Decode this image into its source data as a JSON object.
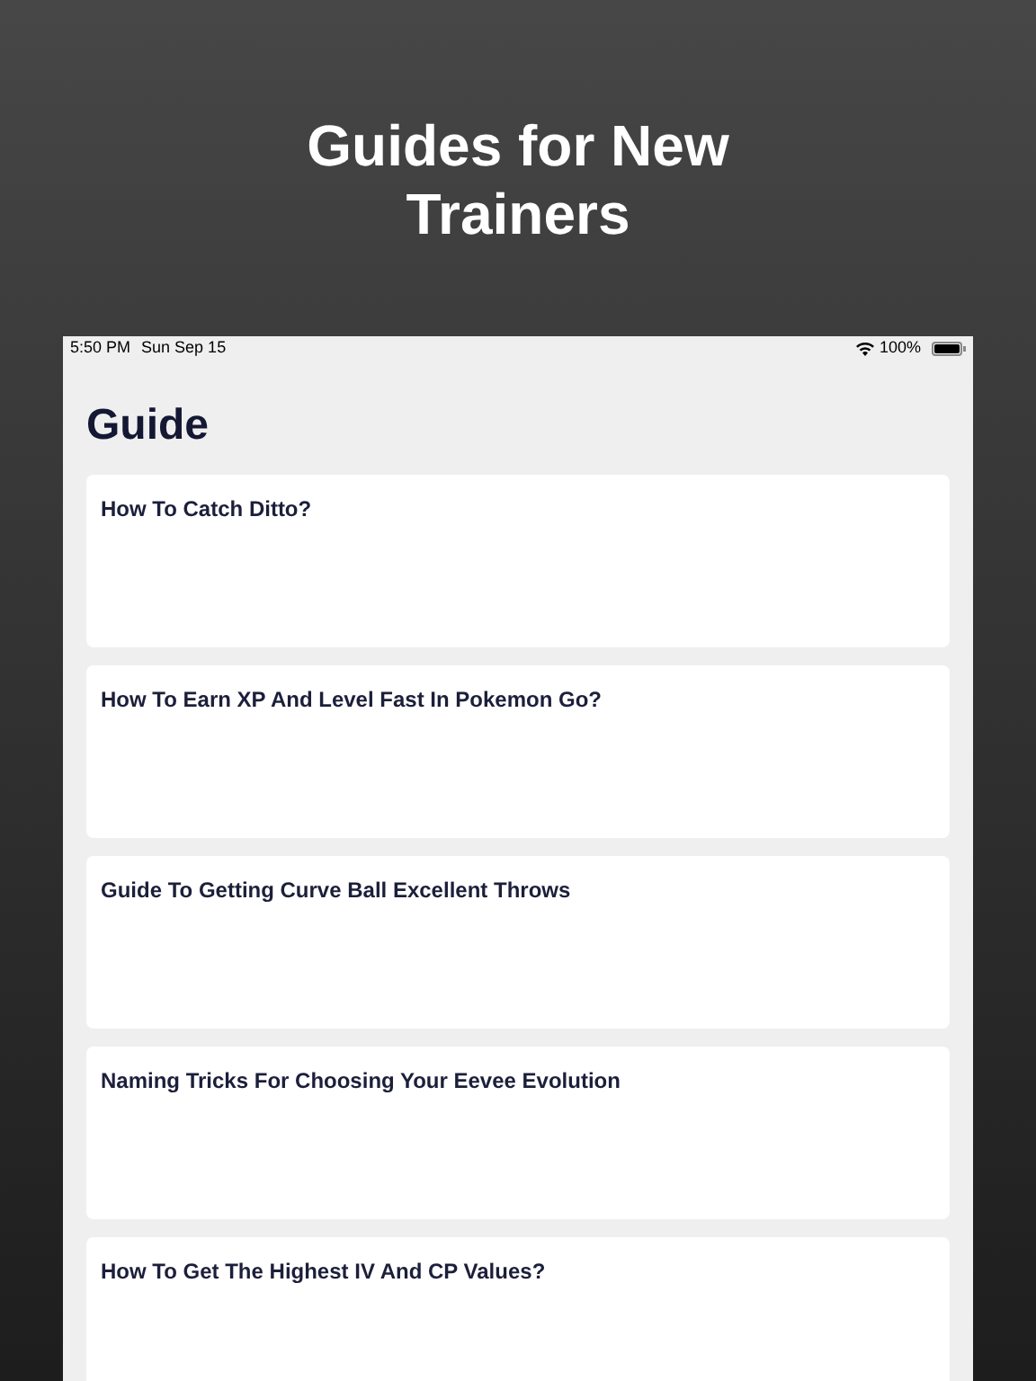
{
  "headline": "Guides for New Trainers",
  "status_bar": {
    "time": "5:50 PM",
    "date": "Sun Sep 15",
    "battery": "100%"
  },
  "title": "Guide",
  "guides": [
    {
      "title": "How To Catch Ditto?"
    },
    {
      "title": "How To Earn XP And Level Fast In Pokemon Go?"
    },
    {
      "title": "Guide To Getting Curve Ball Excellent Throws"
    },
    {
      "title": "Naming Tricks For Choosing Your Eevee Evolution"
    },
    {
      "title": "How To Get The Highest IV And CP Values?"
    }
  ]
}
